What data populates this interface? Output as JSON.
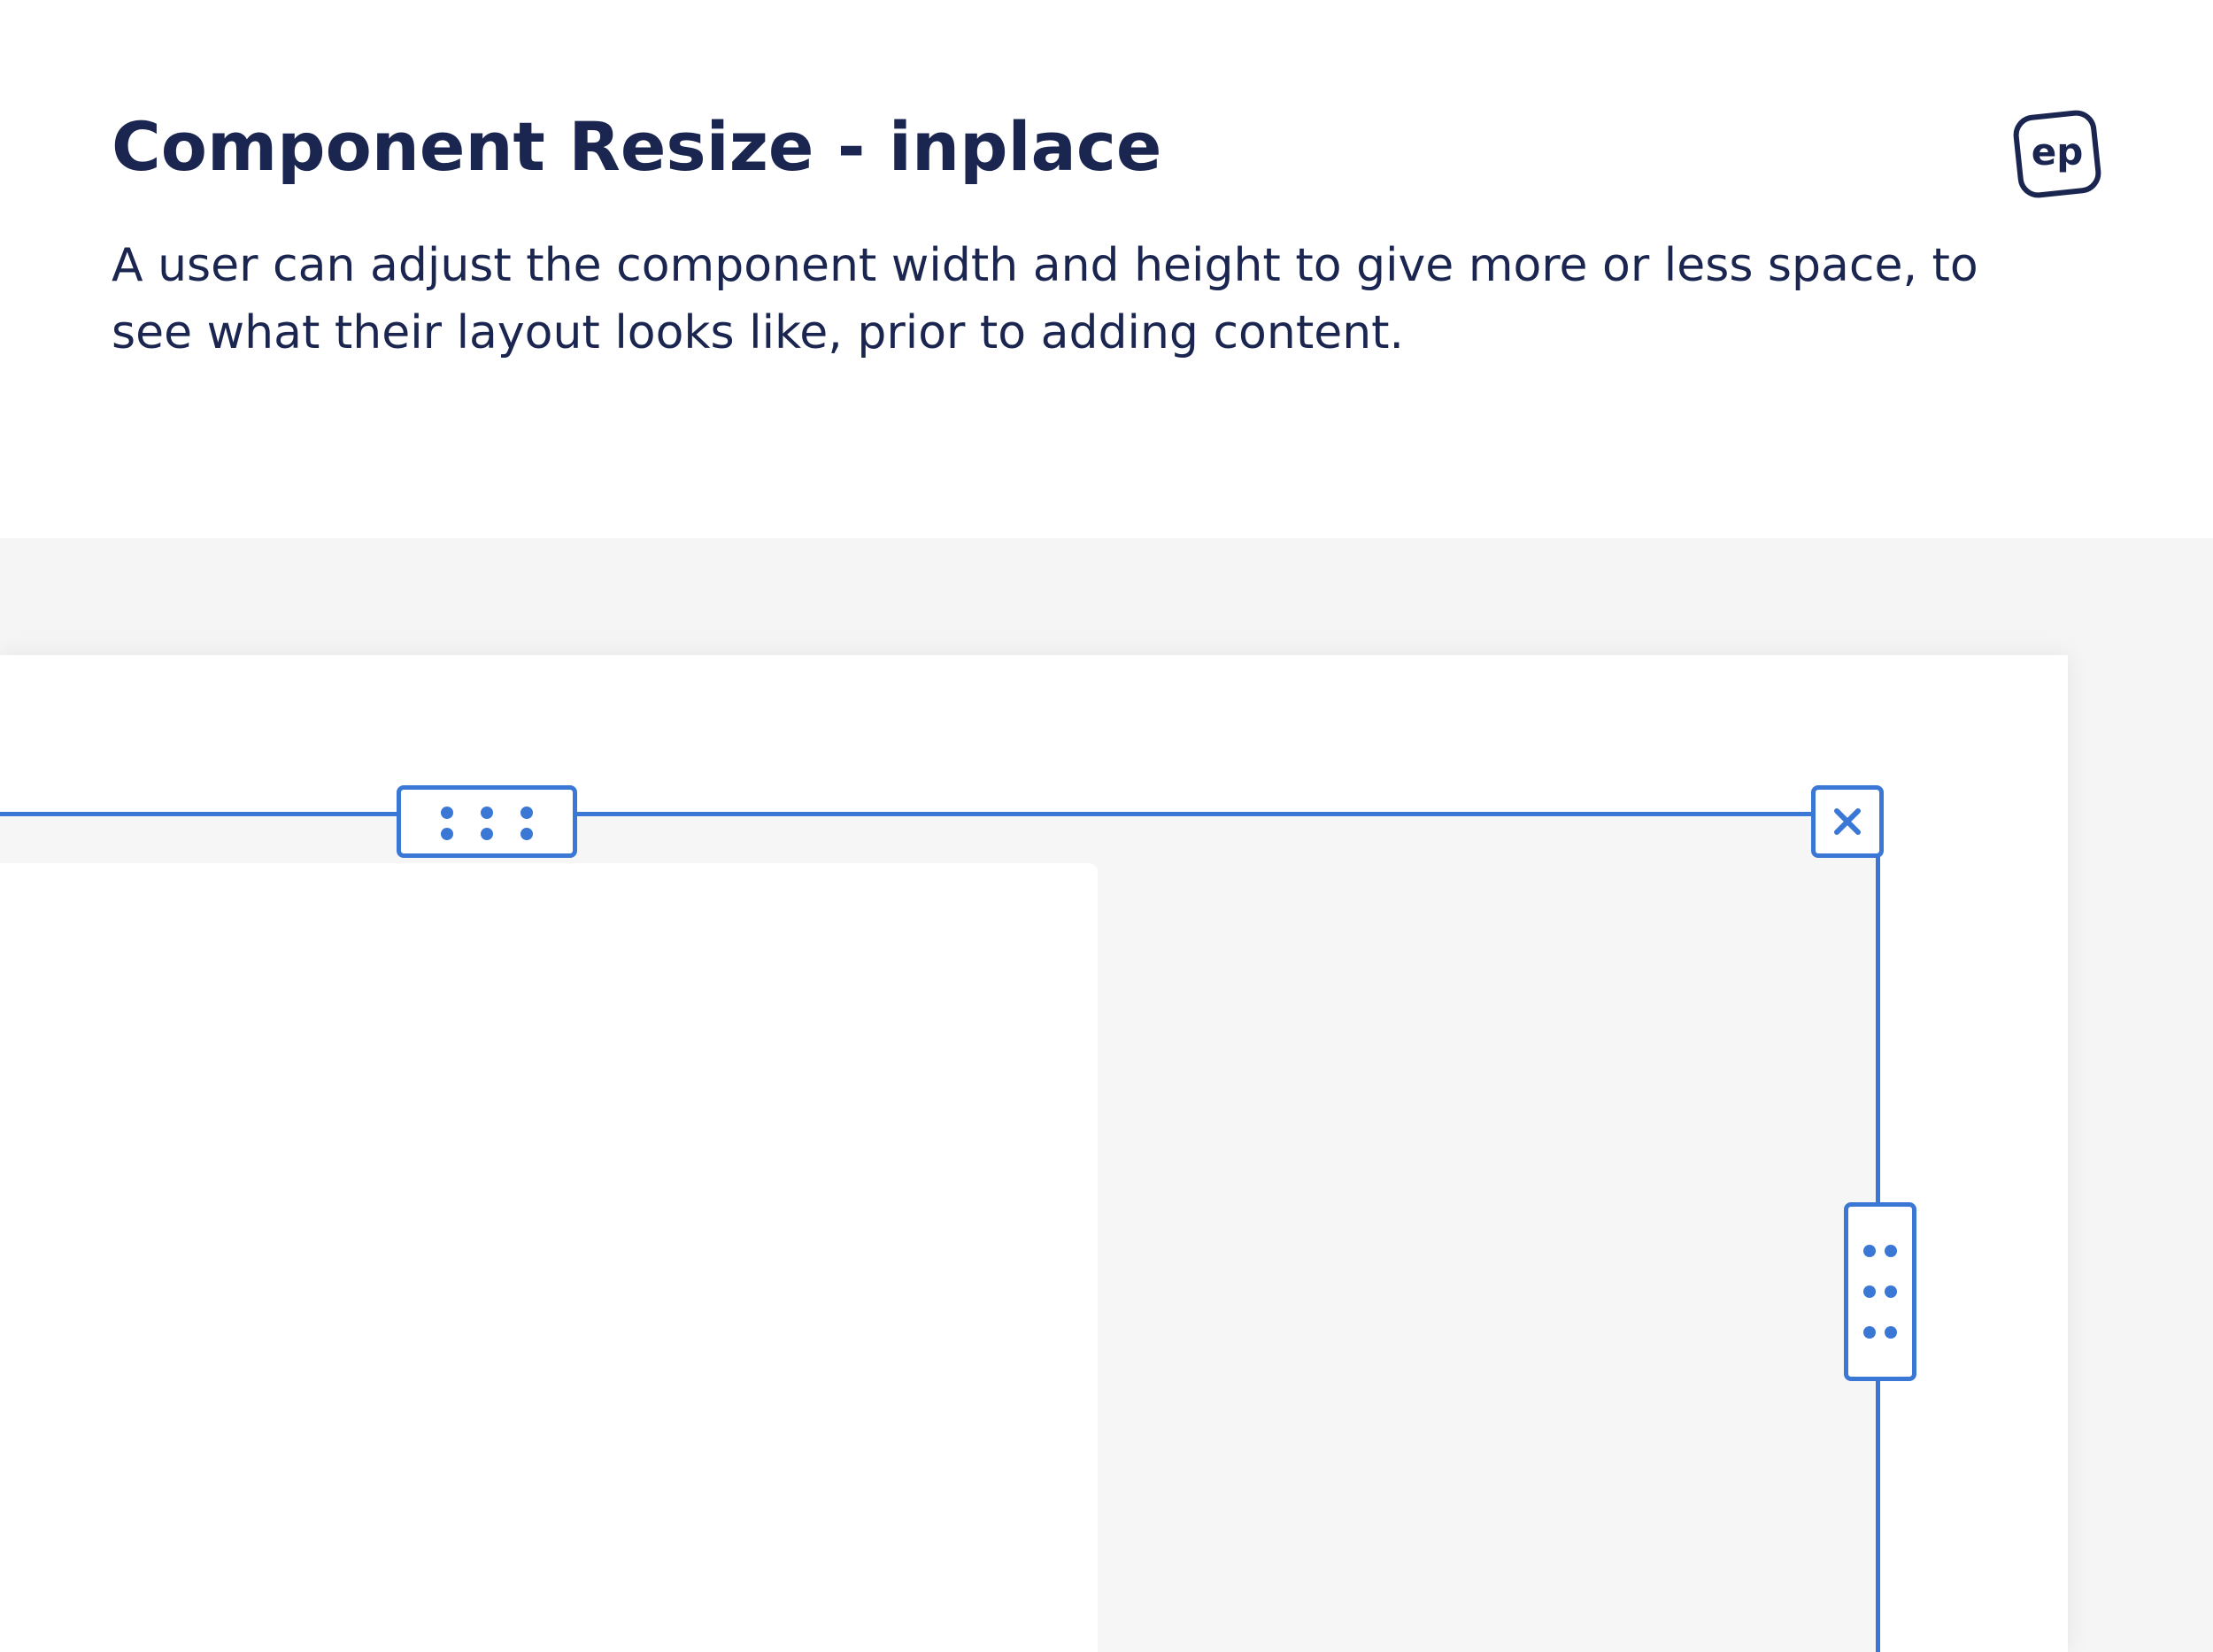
{
  "header": {
    "title": "Component Resize - inplace",
    "description": "A user can adjust the component width and height to give more or less space, to see what their layout looks like, prior to adding content."
  },
  "logo": {
    "text": "ep",
    "icon": "ep-logo"
  },
  "icons": {
    "top_handle": "drag-dots-horizontal-icon",
    "side_handle": "drag-dots-vertical-icon",
    "close": "close-icon"
  },
  "colors": {
    "title_text": "#1a2550",
    "accent": "#3b78d6",
    "canvas_background": "#f5f5f5",
    "component_background": "#f6f6f6",
    "card_background": "#ffffff"
  }
}
